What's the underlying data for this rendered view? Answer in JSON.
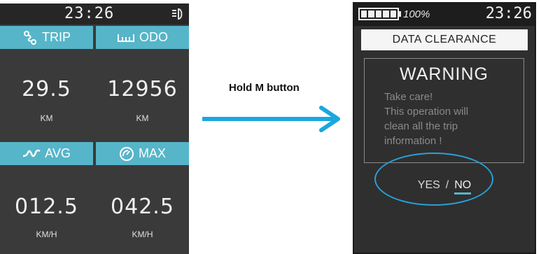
{
  "left_screen": {
    "time": "23:26",
    "tiles": [
      {
        "label": "TRIP",
        "value": "29.5",
        "unit": "KM",
        "icon": "route-icon"
      },
      {
        "label": "ODO",
        "value": "12956",
        "unit": "KM",
        "icon": "ruler-icon"
      },
      {
        "label": "AVG",
        "value": "012.5",
        "unit": "KM/H",
        "icon": "wave-icon"
      },
      {
        "label": "MAX",
        "value": "042.5",
        "unit": "KM/H",
        "icon": "gauge-icon"
      }
    ]
  },
  "transition": {
    "label": "Hold M button",
    "arrow_color": "#1aa7e0"
  },
  "right_screen": {
    "battery_percent": "100%",
    "battery_level": 1.0,
    "time": "23:26",
    "banner": "DATA CLEARANCE",
    "warning_title": "WARNING",
    "warning_lines": [
      "Take care!",
      "This operation will",
      "clean all the trip",
      "information !"
    ],
    "yes": "YES",
    "separator": "/",
    "no": "NO"
  },
  "colors": {
    "accent": "#56b5c9",
    "screen_bg": "#3a3a3a",
    "highlight_ring": "#2aa0d8"
  }
}
